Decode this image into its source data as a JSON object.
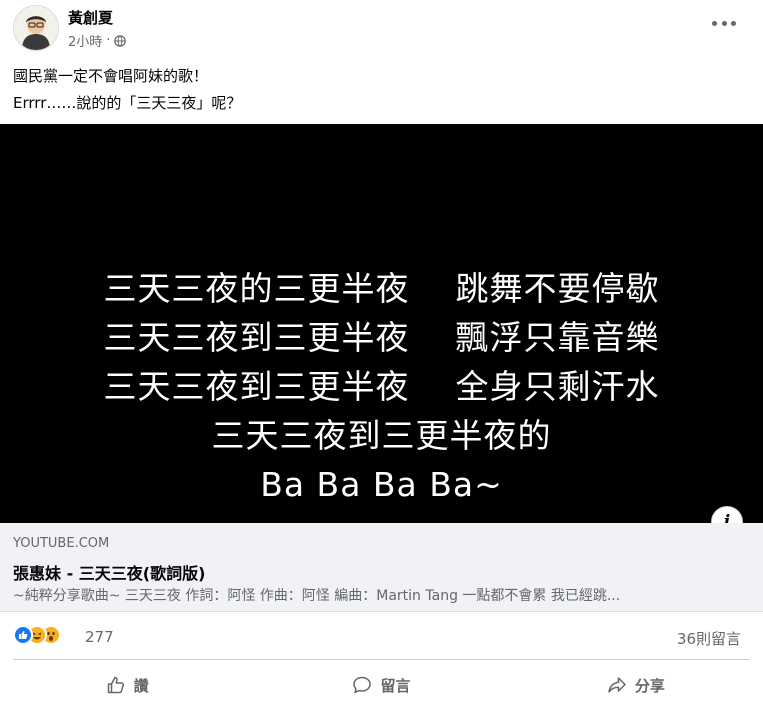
{
  "post": {
    "author": "黃創夏",
    "time": "2小時",
    "privacy_icon": "globe-icon",
    "more_icon": "more-dots-icon",
    "lines": [
      "國民黨一定不會唱阿妹的歌！",
      "Errrr……說的的「三天三夜」呢？"
    ]
  },
  "video": {
    "lyrics": [
      "三天三夜的三更半夜    跳舞不要停歇",
      "三天三夜到三更半夜    飄浮只靠音樂",
      "三天三夜到三更半夜    全身只剩汗水",
      "三天三夜到三更半夜的",
      "Ba Ba Ba Ba~"
    ],
    "info_icon": "info-icon"
  },
  "link_preview": {
    "domain": "YOUTUBE.COM",
    "title": "張惠妹 - 三天三夜(歌詞版)",
    "description": "~純粹分享歌曲~ 三天三夜 作詞：阿怪 作曲：阿怪 編曲：Martin Tang 一點都不會累 我已經跳..."
  },
  "engagement": {
    "reaction_icons": [
      "like-icon",
      "haha-icon",
      "wow-icon"
    ],
    "reaction_count": "277",
    "comment_count": "36則留言"
  },
  "actions": [
    {
      "label": "讚",
      "icon": "thumbs-up-icon"
    },
    {
      "label": "留言",
      "icon": "comment-icon"
    },
    {
      "label": "分享",
      "icon": "share-icon"
    }
  ],
  "colors": {
    "brand_blue": "#1877f2",
    "secondary_text": "#65676b",
    "preview_bg": "#f0f2f5"
  }
}
